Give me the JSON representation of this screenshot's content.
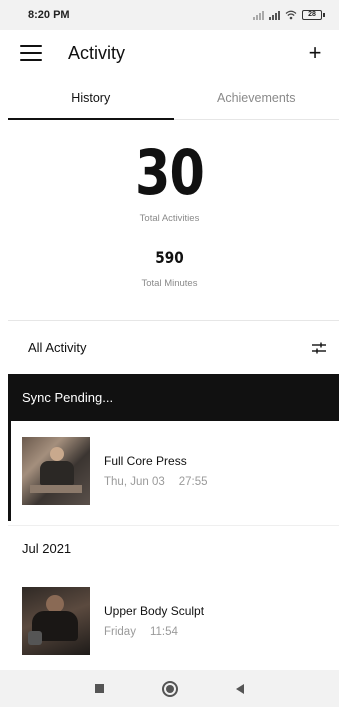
{
  "status_bar": {
    "time": "8:20 PM",
    "battery": "28"
  },
  "header": {
    "title": "Activity"
  },
  "tabs": [
    {
      "label": "History",
      "active": true
    },
    {
      "label": "Achievements",
      "active": false
    }
  ],
  "stats": {
    "total_activities": "30",
    "total_activities_label": "Total Activities",
    "total_minutes": "590",
    "total_minutes_label": "Total Minutes"
  },
  "filter": {
    "label": "All Activity"
  },
  "sync": {
    "label": "Sync Pending..."
  },
  "pending_activities": [
    {
      "name": "Full Core Press",
      "date": "Thu, Jun 03",
      "duration": "27:55"
    }
  ],
  "months": [
    {
      "label": "Jul 2021",
      "activities": [
        {
          "name": "Upper Body Sculpt",
          "date": "Friday",
          "duration": "11:54"
        }
      ]
    }
  ]
}
